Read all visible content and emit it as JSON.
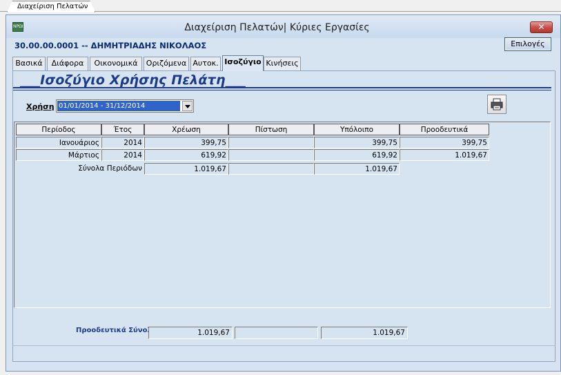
{
  "doc_tab": "Διαχείριση Πελατών",
  "window": {
    "title": "Διαχείριση Πελατών| Κύριες Εργασίες",
    "icon_text": "ΝΡΩΙ",
    "close_symbol": "✕"
  },
  "customer": {
    "line": "30.00.00.0001 -- ΔΗΜΗΤΡΙΑΔΗΣ ΝΙΚΟΛΑΟΣ"
  },
  "options_label": "Επιλογές",
  "tabs": [
    {
      "label": "Βασικά"
    },
    {
      "label": "Διάφορα"
    },
    {
      "label": "Οικονομικά"
    },
    {
      "label": "Οριζόμενα"
    },
    {
      "label": "Αυτοκ."
    },
    {
      "label": "Ισοζύγιο"
    },
    {
      "label": "Κινήσεις"
    }
  ],
  "active_tab": "Ισοζύγιο",
  "section": {
    "title": "___Ισοζύγιο Χρήσης Πελάτη___"
  },
  "fiscal": {
    "label": "Χρήση",
    "value": "01/01/2014 - 31/12/2014"
  },
  "print_icon": "printer-icon",
  "table": {
    "headers": [
      "Περίοδος",
      "Έτος",
      "Χρέωση",
      "Πίστωση",
      "Υπόλοιπο",
      "Προοδευτικά"
    ],
    "rows": [
      [
        "Ιανουάριος",
        "2014",
        "399,75",
        "",
        "399,75",
        "399,75"
      ],
      [
        "Μάρτιος",
        "2014",
        "619,92",
        "",
        "619,92",
        "1.019,67"
      ]
    ],
    "totals": {
      "label": "Σύνολα Περιόδων",
      "debit": "1.019,67",
      "credit": "",
      "balance": "1.019,67"
    }
  },
  "footer": {
    "label": "Προοδευτικά Σύνολα",
    "debit": "1.019,67",
    "credit": "",
    "balance": "1.019,67"
  },
  "colors": {
    "panel": "#d6e4f2",
    "title_blue": "#1d3a8a",
    "selection": "#3164c8",
    "close_red": "#c75050"
  }
}
